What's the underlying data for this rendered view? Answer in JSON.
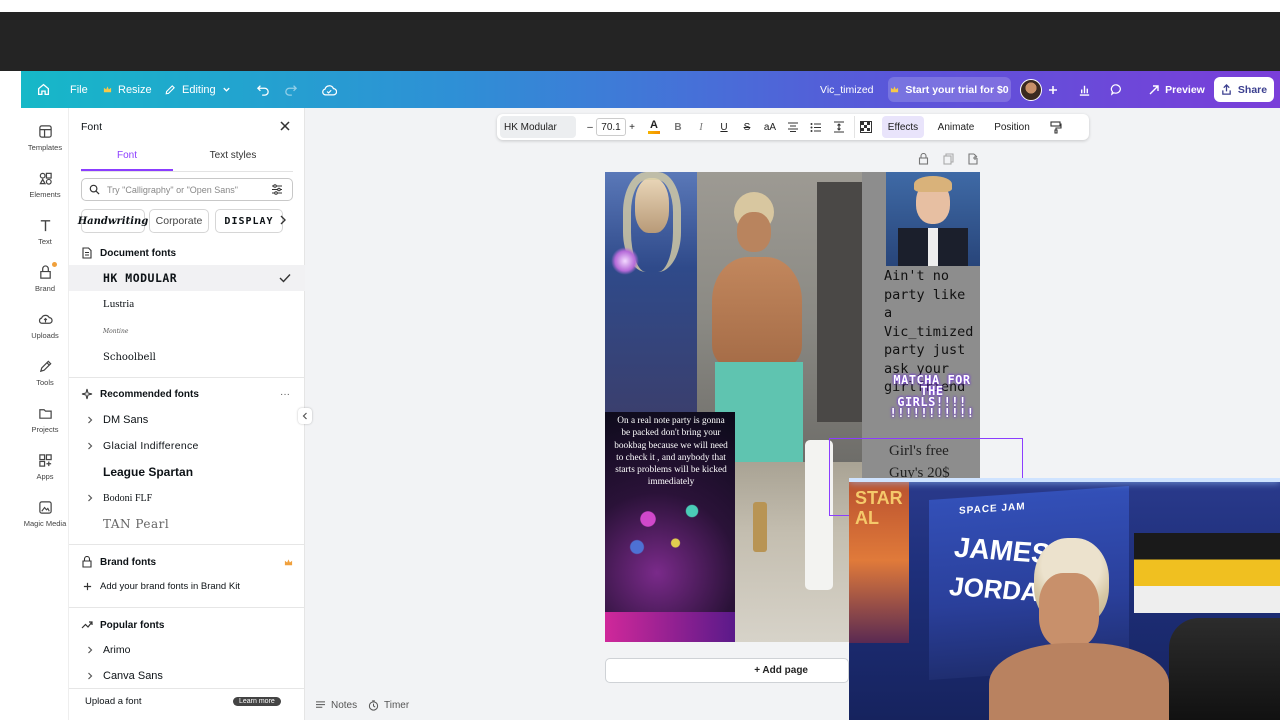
{
  "header": {
    "file": "File",
    "resize": "Resize",
    "editing": "Editing",
    "design_title": "Vic_timized",
    "trial": "Start your trial for $0",
    "preview": "Preview",
    "share": "Share"
  },
  "rail": {
    "templates": "Templates",
    "elements": "Elements",
    "text": "Text",
    "brand": "Brand",
    "uploads": "Uploads",
    "tools": "Tools",
    "projects": "Projects",
    "apps": "Apps",
    "magic_media": "Magic Media"
  },
  "panel": {
    "title": "Font",
    "tab_font": "Font",
    "tab_text_styles": "Text styles",
    "search_placeholder": "Try \"Calligraphy\" or \"Open Sans\"",
    "chips": [
      "Handwriting",
      "Corporate",
      "DISPLAY"
    ],
    "document_fonts_heading": "Document fonts",
    "document_fonts": [
      "HK MODULAR",
      "Lustria",
      "Montine",
      "Schoolbell"
    ],
    "recommended_heading": "Recommended fonts",
    "recommended_fonts": [
      "DM Sans",
      "Glacial Indifference",
      "League Spartan",
      "Bodoni FLF",
      "TAN Pearl"
    ],
    "brand_fonts_heading": "Brand fonts",
    "brand_fonts_add": "Add your brand fonts in Brand Kit",
    "popular_heading": "Popular fonts",
    "popular_fonts": [
      "Arimo",
      "Canva Sans"
    ],
    "upload_font": "Upload a font",
    "learn_more": "Learn more"
  },
  "toolbar": {
    "font_name": "HK Modular",
    "font_size": "70.1",
    "effects": "Effects",
    "animate": "Animate",
    "position": "Position"
  },
  "design": {
    "text_party": "Ain't no party like a Vic_timized party just ask your girlfriend",
    "text_matcha": "MATCHA FOR THE GIRLS!!!! !!!!!!!!!!!",
    "text_note": "On a real note party is gonna be packed don't bring your bookbag because we will need to check it , and anybody that starts problems will be kicked immediately",
    "text_price_1": "Girl's free",
    "text_price_2": "Guy's 20$",
    "add_page": "+ Add page"
  },
  "webcam": {
    "banner_text_1": "JAMES",
    "banner_text_2": "JORDAN",
    "banner_small": "SPACE JAM",
    "flag_text": "STAR AL"
  },
  "bottom": {
    "notes": "Notes",
    "timer": "Timer"
  },
  "colors": {
    "accent": "#8b3dff",
    "header_start": "#16b8c8",
    "header_end": "#7a3ed9"
  }
}
